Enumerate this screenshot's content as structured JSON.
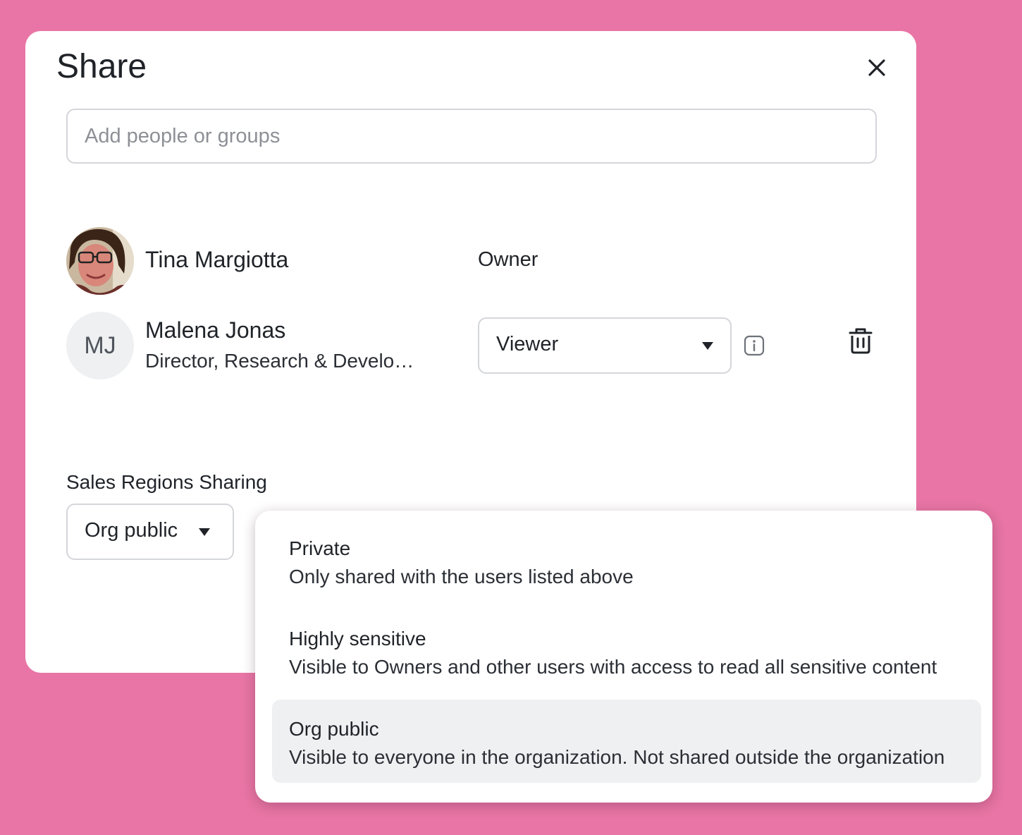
{
  "theme": {
    "backdrop": "#e875a5",
    "surface": "#ffffff",
    "border": "#d4d6da",
    "selected": "#eff0f2"
  },
  "dialog": {
    "title": "Share",
    "close_icon": "close-icon"
  },
  "search": {
    "placeholder": "Add people or groups",
    "value": ""
  },
  "people": [
    {
      "name": "Tina Margiotta",
      "role": "Owner",
      "avatar": "photo"
    },
    {
      "initials": "MJ",
      "name": "Malena Jonas",
      "subtitle": "Director, Research & Develo…",
      "role": "Viewer",
      "info_icon": "info-icon",
      "delete_icon": "trash-icon"
    }
  ],
  "sharing": {
    "label": "Sales Regions Sharing",
    "selected": "Org public",
    "options": [
      {
        "title": "Private",
        "description": "Only shared with the users listed above"
      },
      {
        "title": "Highly sensitive",
        "description": "Visible to Owners and other users with access to read all sensitive content"
      },
      {
        "title": "Org public",
        "description": "Visible to everyone in the organization. Not shared outside the organization",
        "selected": true
      }
    ]
  }
}
